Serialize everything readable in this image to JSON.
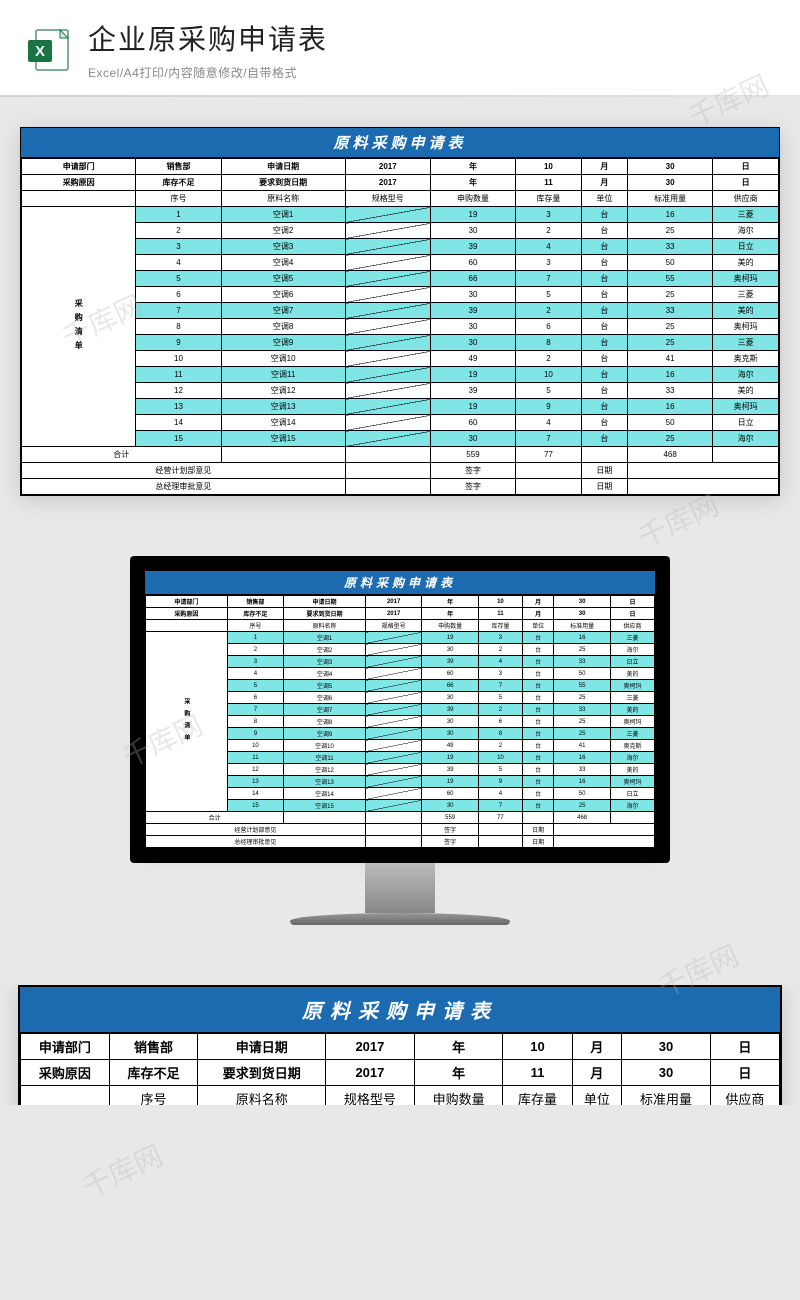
{
  "header": {
    "title": "企业原采购申请表",
    "subtitle": "Excel/A4打印/内容随意修改/自带格式"
  },
  "sheet": {
    "title": "原料采购申请表",
    "meta_row1": {
      "c1": "申请部门",
      "c2": "销售部",
      "c3": "申请日期",
      "c4": "2017",
      "c5": "年",
      "c6": "10",
      "c7": "月",
      "c8": "30",
      "c9": "日"
    },
    "meta_row2": {
      "c1": "采购原因",
      "c2": "库存不足",
      "c3": "要求到货日期",
      "c4": "2017",
      "c5": "年",
      "c6": "11",
      "c7": "月",
      "c8": "30",
      "c9": "日"
    },
    "cols": {
      "c2": "序号",
      "c3": "原料名称",
      "c4": "规格型号",
      "c5": "申购数量",
      "c6": "库存量",
      "c7": "单位",
      "c8": "标准用量",
      "c9": "供应商"
    },
    "side_label": "采购清单",
    "rows": [
      {
        "n": "1",
        "name": "空调1",
        "qty": "19",
        "stock": "3",
        "unit": "台",
        "std": "16",
        "sup": "三菱"
      },
      {
        "n": "2",
        "name": "空调2",
        "qty": "30",
        "stock": "2",
        "unit": "台",
        "std": "25",
        "sup": "海尔"
      },
      {
        "n": "3",
        "name": "空调3",
        "qty": "39",
        "stock": "4",
        "unit": "台",
        "std": "33",
        "sup": "日立"
      },
      {
        "n": "4",
        "name": "空调4",
        "qty": "60",
        "stock": "3",
        "unit": "台",
        "std": "50",
        "sup": "美的"
      },
      {
        "n": "5",
        "name": "空调5",
        "qty": "66",
        "stock": "7",
        "unit": "台",
        "std": "55",
        "sup": "奥柯玛"
      },
      {
        "n": "6",
        "name": "空调6",
        "qty": "30",
        "stock": "5",
        "unit": "台",
        "std": "25",
        "sup": "三菱"
      },
      {
        "n": "7",
        "name": "空调7",
        "qty": "39",
        "stock": "2",
        "unit": "台",
        "std": "33",
        "sup": "美的"
      },
      {
        "n": "8",
        "name": "空调8",
        "qty": "30",
        "stock": "6",
        "unit": "台",
        "std": "25",
        "sup": "奥柯玛"
      },
      {
        "n": "9",
        "name": "空调9",
        "qty": "30",
        "stock": "8",
        "unit": "台",
        "std": "25",
        "sup": "三菱"
      },
      {
        "n": "10",
        "name": "空调10",
        "qty": "49",
        "stock": "2",
        "unit": "台",
        "std": "41",
        "sup": "奥克斯"
      },
      {
        "n": "11",
        "name": "空调11",
        "qty": "19",
        "stock": "10",
        "unit": "台",
        "std": "16",
        "sup": "海尔"
      },
      {
        "n": "12",
        "name": "空调12",
        "qty": "39",
        "stock": "5",
        "unit": "台",
        "std": "33",
        "sup": "美的"
      },
      {
        "n": "13",
        "name": "空调13",
        "qty": "19",
        "stock": "9",
        "unit": "台",
        "std": "16",
        "sup": "奥柯玛"
      },
      {
        "n": "14",
        "name": "空调14",
        "qty": "60",
        "stock": "4",
        "unit": "台",
        "std": "50",
        "sup": "日立"
      },
      {
        "n": "15",
        "name": "空调15",
        "qty": "30",
        "stock": "7",
        "unit": "台",
        "std": "25",
        "sup": "海尔"
      }
    ],
    "total": {
      "label": "合计",
      "qty": "559",
      "stock": "77",
      "std": "468"
    },
    "foot1": {
      "c1": "经营计划部意见",
      "c2": "签字",
      "c3": "日期"
    },
    "foot2": {
      "c1": "总经理审批意见",
      "c2": "签字",
      "c3": "日期"
    }
  },
  "watermark": "千库网"
}
